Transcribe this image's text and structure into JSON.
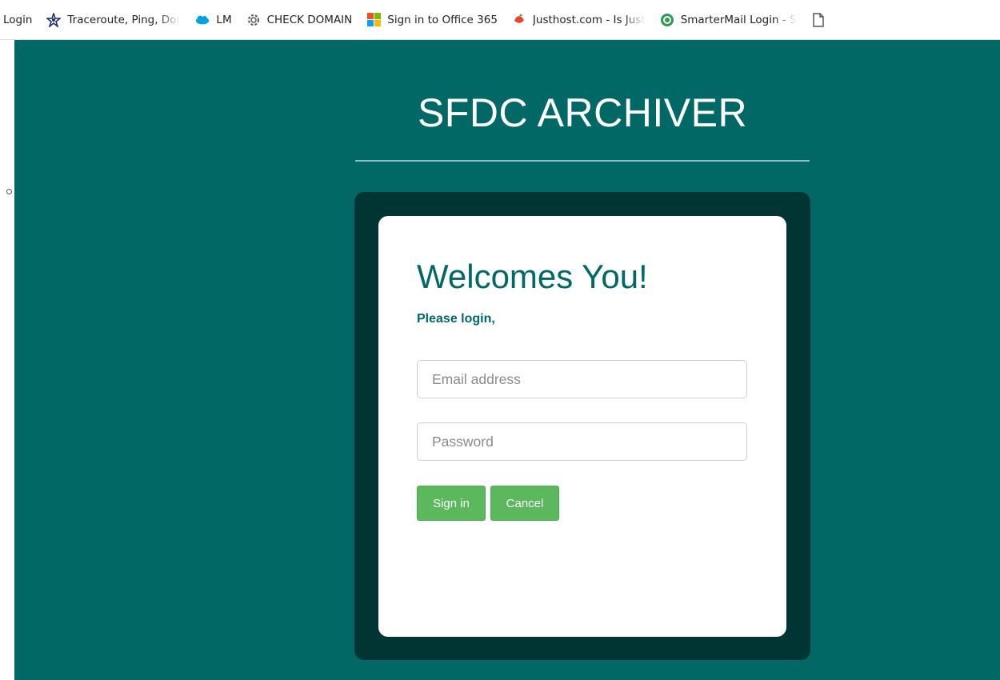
{
  "bookmarks": [
    {
      "label": "Login",
      "icon": "partial-cut-icon",
      "icon_color": "#1a73e8"
    },
    {
      "label": "Traceroute, Ping, Dom",
      "icon": "network-star-icon",
      "icon_color": "#1f2d70"
    },
    {
      "label": "LM",
      "icon": "cloud-icon",
      "icon_color": "#00a1e0"
    },
    {
      "label": "CHECK DOMAIN",
      "icon": "gear-icon",
      "icon_color": "#555555"
    },
    {
      "label": "Sign in to Office 365",
      "icon": "microsoft-logo-icon",
      "icon_color": "#f25022"
    },
    {
      "label": "Justhost.com - Is Just",
      "icon": "justhost-icon",
      "icon_color": "#e04a2a"
    },
    {
      "label": "SmarterMail Login - S",
      "icon": "smartermail-icon",
      "icon_color": "#2a9d52"
    },
    {
      "label": "",
      "icon": "page-icon",
      "icon_color": "#555555"
    }
  ],
  "app": {
    "title": "SFDC ARCHIVER",
    "background_color": "#016866",
    "panel_color": "#003533"
  },
  "login": {
    "heading": "Welcomes You!",
    "subheading": "Please login,",
    "email_placeholder": "Email address",
    "email_value": "",
    "password_placeholder": "Password",
    "password_value": "",
    "signin_label": "Sign in",
    "cancel_label": "Cancel",
    "button_color": "#5cb85c"
  }
}
